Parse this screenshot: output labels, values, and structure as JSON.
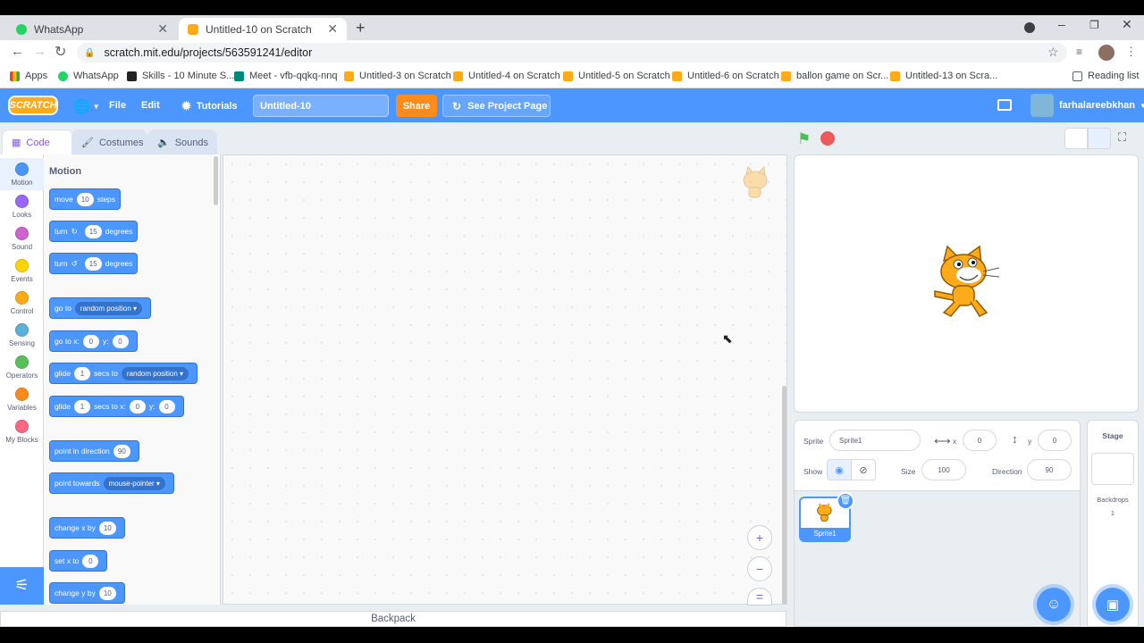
{
  "browser": {
    "tabs": [
      {
        "title": "WhatsApp",
        "close": "✕"
      },
      {
        "title": "Untitled-10 on Scratch",
        "close": "✕"
      }
    ],
    "new_tab": "+",
    "url": "scratch.mit.edu/projects/563591241/editor",
    "bookmarks": [
      "Apps",
      "WhatsApp",
      "Skills - 10 Minute S...",
      "Meet - vfb-qqkq-nnq",
      "Untitled-3 on Scratch",
      "Untitled-4 on Scratch",
      "Untitled-5 on Scratch",
      "Untitled-6 on Scratch",
      "ballon game on Scr...",
      "Untitled-13 on Scra..."
    ],
    "reading_list": "Reading list"
  },
  "menubar": {
    "logo": "SCRATCH",
    "file": "File",
    "edit": "Edit",
    "tutorials": "Tutorials",
    "project_title": "Untitled-10",
    "share": "Share",
    "see_project_page": "See Project Page",
    "username": "farhalareebkhan"
  },
  "editor_tabs": {
    "code": "Code",
    "costumes": "Costumes",
    "sounds": "Sounds"
  },
  "categories": [
    {
      "label": "Motion",
      "color": "#4c97ff"
    },
    {
      "label": "Looks",
      "color": "#9966ff"
    },
    {
      "label": "Sound",
      "color": "#cf63cf"
    },
    {
      "label": "Events",
      "color": "#ffd500"
    },
    {
      "label": "Control",
      "color": "#ffab19"
    },
    {
      "label": "Sensing",
      "color": "#5cb1d6"
    },
    {
      "label": "Operators",
      "color": "#59c059"
    },
    {
      "label": "Variables",
      "color": "#ff8c1a"
    },
    {
      "label": "My Blocks",
      "color": "#ff6680"
    }
  ],
  "palette": {
    "heading": "Motion",
    "move": {
      "pre": "move",
      "val": "10",
      "post": "steps"
    },
    "turn_right": {
      "pre": "turn",
      "val": "15",
      "post": "degrees"
    },
    "turn_left": {
      "pre": "turn",
      "val": "15",
      "post": "degrees"
    },
    "goto": {
      "pre": "go to",
      "dd": "random position"
    },
    "gotoxy": {
      "pre": "go to x:",
      "x": "0",
      "mid": "y:",
      "y": "0"
    },
    "glide1": {
      "pre": "glide",
      "val": "1",
      "mid": "secs to",
      "dd": "random position"
    },
    "glide2": {
      "pre": "glide",
      "val": "1",
      "mid": "secs to x:",
      "x": "0",
      "mid2": "y:",
      "y": "0"
    },
    "point_dir": {
      "pre": "point in direction",
      "val": "90"
    },
    "point_towards": {
      "pre": "point towards",
      "dd": "mouse-pointer"
    },
    "change_x": {
      "pre": "change x by",
      "val": "10"
    },
    "set_x": {
      "pre": "set x to",
      "val": "0"
    },
    "change_y": {
      "pre": "change y by",
      "val": "10"
    }
  },
  "zoom": {
    "in": "+",
    "out": "−",
    "reset": "="
  },
  "backpack": "Backpack",
  "sprite_info": {
    "sprite_label": "Sprite",
    "sprite_name": "Sprite1",
    "x_label": "x",
    "x": "0",
    "y_label": "y",
    "y": "0",
    "show_label": "Show",
    "size_label": "Size",
    "size": "100",
    "direction_label": "Direction",
    "direction": "90"
  },
  "sprite_thumb": {
    "name": "Sprite1"
  },
  "stage_pane": {
    "title": "Stage",
    "backdrops_label": "Backdrops",
    "backdrops_count": "1"
  },
  "colors": {
    "scratch_blue": "#4c97ff",
    "share_orange": "#ff8c1a",
    "green_flag": "#4cbf56",
    "stop": "#ec5959"
  }
}
